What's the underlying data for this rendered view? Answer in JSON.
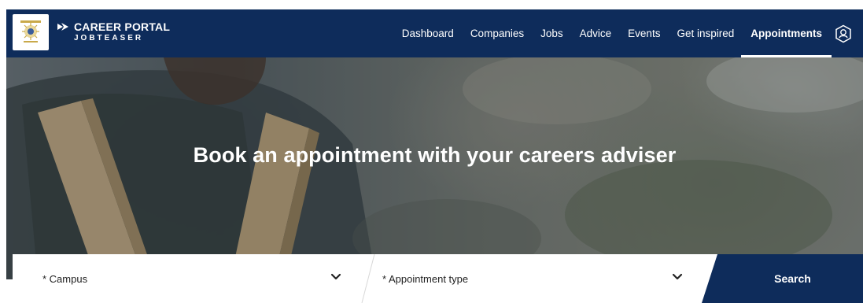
{
  "brand": {
    "title": "CAREER PORTAL",
    "subtitle": "JOBTEASER",
    "logo_icon": "university-seal-icon",
    "colors": {
      "navy": "#0e2c5b",
      "white": "#ffffff"
    }
  },
  "nav": {
    "items": [
      {
        "label": "Dashboard",
        "active": false
      },
      {
        "label": "Companies",
        "active": false
      },
      {
        "label": "Jobs",
        "active": false
      },
      {
        "label": "Advice",
        "active": false
      },
      {
        "label": "Events",
        "active": false
      },
      {
        "label": "Get inspired",
        "active": false
      },
      {
        "label": "Appointments",
        "active": true
      }
    ],
    "profile_icon": "user-hexagon-icon"
  },
  "hero": {
    "title": "Book an appointment with your careers adviser"
  },
  "search": {
    "campus_label": "* Campus",
    "appointment_type_label": "* Appointment type",
    "button_label": "Search",
    "dropdown_icon": "chevron-down-icon"
  }
}
